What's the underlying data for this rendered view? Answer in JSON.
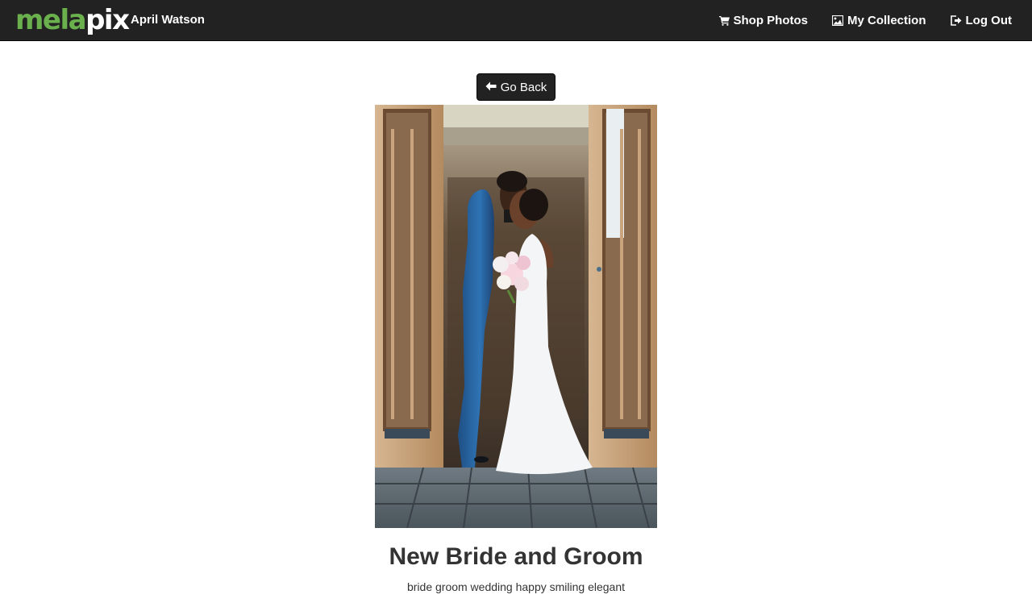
{
  "navbar": {
    "brand": {
      "part1": "mela",
      "part2": "pix",
      "color_primary": "#6ab04c",
      "color_secondary": "#ffffff"
    },
    "user_name": "April Watson",
    "links": [
      {
        "label": "Shop Photos",
        "icon": "shopping-cart-icon"
      },
      {
        "label": "My Collection",
        "icon": "picture-icon"
      },
      {
        "label": "Log Out",
        "icon": "log-out-icon"
      }
    ],
    "background": "#222222"
  },
  "main": {
    "back_button": {
      "label": "Go Back",
      "icon": "arrow-left-icon"
    },
    "photo": {
      "kind": "wedding photo: groom in blue suit and bride in white gown with bouquet in a doorway"
    },
    "title": "New Bride and Groom",
    "tags": "bride groom wedding happy smiling elegant"
  }
}
